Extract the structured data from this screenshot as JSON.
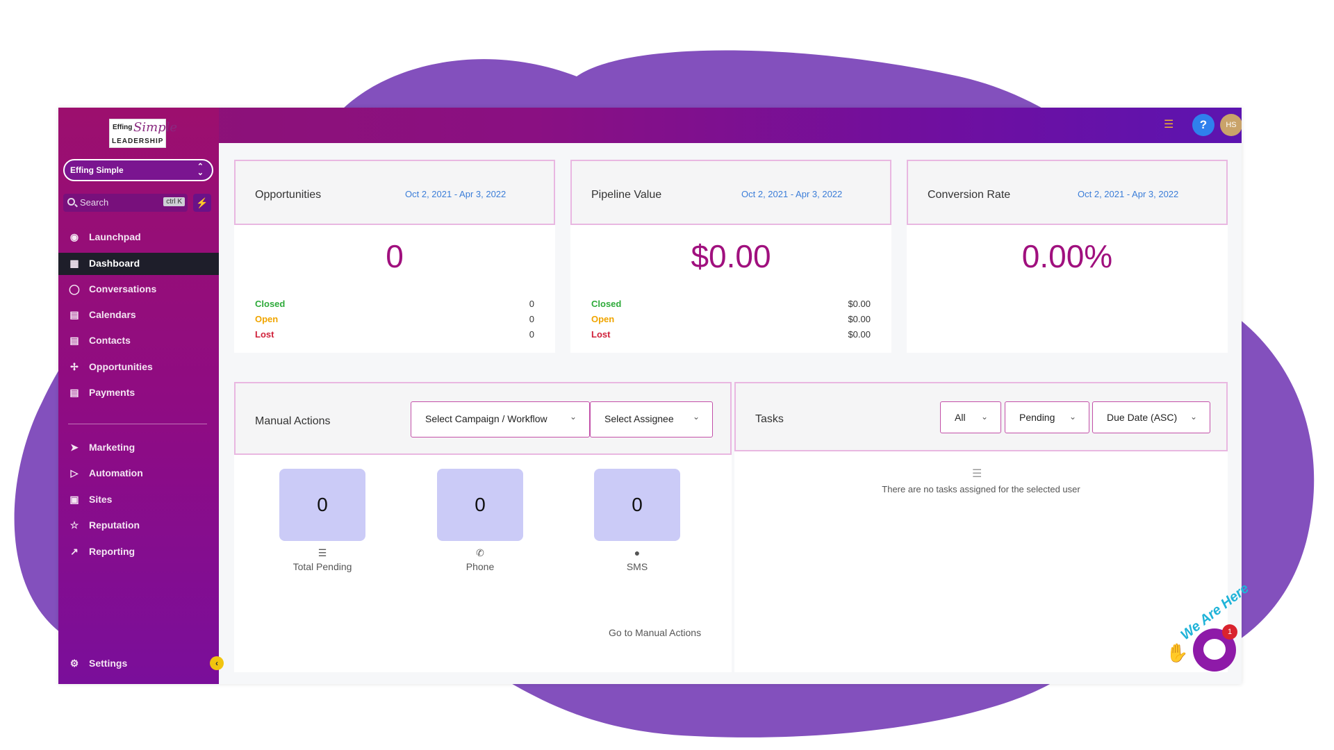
{
  "brand": {
    "logo_line1": "Effing",
    "logo_line2": "Simple",
    "logo_line3": "LEADERSHIP"
  },
  "account": {
    "name": "Effing Simple"
  },
  "search": {
    "placeholder": "Search",
    "shortcut": "ctrl K"
  },
  "sidebar": {
    "items": [
      {
        "label": "Launchpad",
        "icon": "rocket-icon"
      },
      {
        "label": "Dashboard",
        "icon": "grid-icon",
        "active": true
      },
      {
        "label": "Conversations",
        "icon": "chat-icon"
      },
      {
        "label": "Calendars",
        "icon": "calendar-icon"
      },
      {
        "label": "Contacts",
        "icon": "contacts-icon"
      },
      {
        "label": "Opportunities",
        "icon": "opportunities-icon"
      },
      {
        "label": "Payments",
        "icon": "payments-icon"
      }
    ],
    "items2": [
      {
        "label": "Marketing",
        "icon": "send-icon"
      },
      {
        "label": "Automation",
        "icon": "play-icon"
      },
      {
        "label": "Sites",
        "icon": "sites-icon"
      },
      {
        "label": "Reputation",
        "icon": "star-icon"
      },
      {
        "label": "Reporting",
        "icon": "trend-icon"
      }
    ],
    "settings": "Settings"
  },
  "topbar": {
    "help": "?",
    "avatar_initials": "HS"
  },
  "kpis": [
    {
      "title": "Opportunities",
      "date": "Oct 2, 2021 - Apr 3, 2022",
      "value": "0",
      "rows": [
        {
          "label": "Closed",
          "value": "0",
          "color": "#2eaa3a"
        },
        {
          "label": "Open",
          "value": "0",
          "color": "#f0a500"
        },
        {
          "label": "Lost",
          "value": "0",
          "color": "#d0213a"
        }
      ]
    },
    {
      "title": "Pipeline Value",
      "date": "Oct 2, 2021 - Apr 3, 2022",
      "value": "$0.00",
      "rows": [
        {
          "label": "Closed",
          "value": "$0.00",
          "color": "#2eaa3a"
        },
        {
          "label": "Open",
          "value": "$0.00",
          "color": "#f0a500"
        },
        {
          "label": "Lost",
          "value": "$0.00",
          "color": "#d0213a"
        }
      ]
    },
    {
      "title": "Conversion Rate",
      "date": "Oct 2, 2021 - Apr 3, 2022",
      "value": "0.00%"
    }
  ],
  "manual_actions": {
    "title": "Manual Actions",
    "campaign_select": "Select Campaign / Workflow",
    "assignee_select": "Select Assignee",
    "tiles": [
      {
        "value": "0",
        "label": "Total Pending",
        "icon": "list-icon"
      },
      {
        "value": "0",
        "label": "Phone",
        "icon": "phone-icon"
      },
      {
        "value": "0",
        "label": "SMS",
        "icon": "sms-icon"
      }
    ],
    "link": "Go to Manual Actions"
  },
  "tasks": {
    "title": "Tasks",
    "filter_all": "All",
    "filter_status": "Pending",
    "filter_sort": "Due Date (ASC)",
    "empty": "There are no tasks assigned for the selected user"
  },
  "chat_widget": {
    "text": "We Are Here",
    "badge": "1"
  }
}
